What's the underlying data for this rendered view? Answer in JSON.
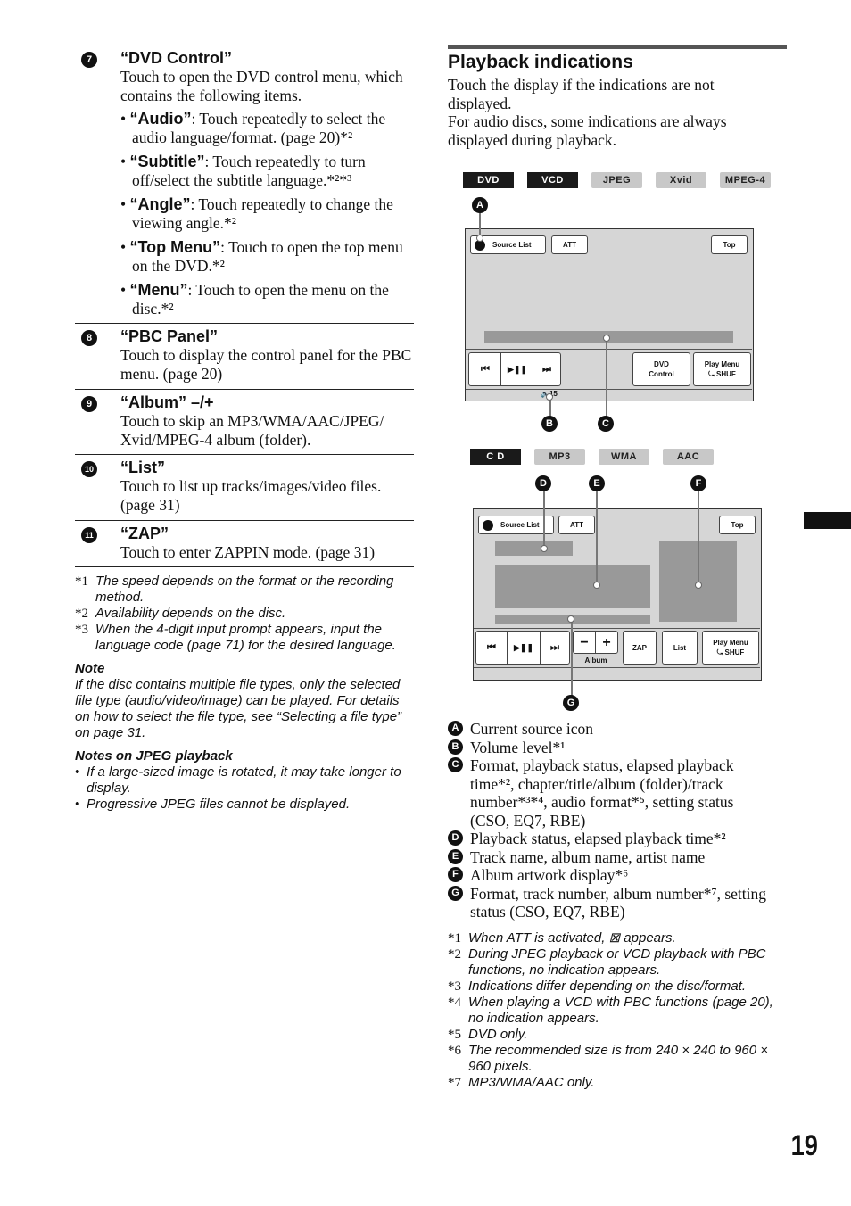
{
  "left": {
    "sections": [
      {
        "num": "7",
        "title": "“DVD Control”",
        "text": "Touch to open the DVD control menu, which contains the following items.",
        "bullets": [
          {
            "term": "“Audio”",
            "text": ": Touch repeatedly to select the audio language/format. (page 20)*²"
          },
          {
            "term": "“Subtitle”",
            "text": ": Touch repeatedly to turn off/select the subtitle language.*²*³"
          },
          {
            "term": "“Angle”",
            "text": ": Touch repeatedly to change the viewing angle.*²"
          },
          {
            "term": "“Top Menu”",
            "text": ": Touch to open the top menu on the DVD.*²"
          },
          {
            "term": "“Menu”",
            "text": ": Touch to open the menu on the disc.*²"
          }
        ]
      },
      {
        "num": "8",
        "title": "“PBC Panel”",
        "text": "Touch to display the control panel for the PBC menu. (page 20)"
      },
      {
        "num": "9",
        "title": "“Album” –/+",
        "text": "Touch to skip an MP3/WMA/AAC/JPEG/ Xvid/MPEG-4 album (folder)."
      },
      {
        "num": "10",
        "title": "“List”",
        "text": "Touch to list up tracks/images/video files. (page 31)"
      },
      {
        "num": "11",
        "title": "“ZAP”",
        "text": "Touch to enter ZAPPIN mode. (page 31)"
      }
    ],
    "footnotes": [
      {
        "mark": "*1",
        "text": "The speed depends on the format or the recording method."
      },
      {
        "mark": "*2",
        "text": "Availability depends on the disc."
      },
      {
        "mark": "*3",
        "text": "When the 4-digit input prompt appears, input the language code (page 71) for the desired language."
      }
    ],
    "note_title": "Note",
    "note_text": "If the disc contains multiple file types, only the selected file type (audio/video/image) can be played. For details on how to select the file type, see “Selecting a file type” on page 31.",
    "jpeg_title": "Notes on JPEG playback",
    "jpeg_bullets": [
      "If a large-sized image is rotated, it may take longer to display.",
      "Progressive JPEG files cannot be displayed."
    ]
  },
  "right": {
    "title": "Playback indications",
    "intro1": "Touch the display if the indications are not displayed.",
    "intro2": "For audio discs, some indications are always displayed during playback.",
    "diagram1": {
      "tags": [
        {
          "label": "DVD",
          "active": true
        },
        {
          "label": "VCD",
          "active": true
        },
        {
          "label": "JPEG",
          "active": false
        },
        {
          "label": "Xvid",
          "active": false
        },
        {
          "label": "MPEG-4",
          "active": false
        }
      ],
      "source_list": "Source List",
      "att": "ATT",
      "top": "Top",
      "prev_icon": "⏮",
      "play_pause_icon": "▶❚❚",
      "next_icon": "⏭",
      "dvd_control_1": "DVD",
      "dvd_control_2": "Control",
      "play_menu": "Play Menu",
      "shuf": "⤿ SHUF",
      "volume": "🔈15",
      "callouts": [
        "A",
        "B",
        "C"
      ]
    },
    "diagram2": {
      "tags": [
        {
          "label": "C D",
          "active": true
        },
        {
          "label": "MP3",
          "active": false
        },
        {
          "label": "WMA",
          "active": false
        },
        {
          "label": "AAC",
          "active": false
        }
      ],
      "source_list": "Source List",
      "att": "ATT",
      "top": "Top",
      "minus": "−",
      "plus": "+",
      "album": "Album",
      "zap": "ZAP",
      "list": "List",
      "play_menu": "Play Menu",
      "shuf": "⤿ SHUF",
      "callouts": [
        "D",
        "E",
        "F",
        "G"
      ]
    },
    "legend": [
      {
        "letter": "A",
        "text": "Current source icon"
      },
      {
        "letter": "B",
        "text": "Volume level*¹"
      },
      {
        "letter": "C",
        "text": "Format, playback status, elapsed playback time*², chapter/title/album (folder)/track number*³*⁴, audio format*⁵, setting status (CSO, EQ7, RBE)"
      },
      {
        "letter": "D",
        "text": "Playback status, elapsed playback time*²"
      },
      {
        "letter": "E",
        "text": "Track name, album name, artist name"
      },
      {
        "letter": "F",
        "text": "Album artwork display*⁶"
      },
      {
        "letter": "G",
        "text": "Format, track number, album number*⁷, setting status (CSO, EQ7, RBE)"
      }
    ],
    "footnotes": [
      {
        "mark": "*1",
        "text": "When ATT is activated, ⊠ appears."
      },
      {
        "mark": "*2",
        "text": "During JPEG playback or VCD playback with PBC functions, no indication appears."
      },
      {
        "mark": "*3",
        "text": "Indications differ depending on the disc/format."
      },
      {
        "mark": "*4",
        "text": "When playing a VCD with PBC functions (page 20), no indication appears."
      },
      {
        "mark": "*5",
        "text": "DVD only."
      },
      {
        "mark": "*6",
        "text": "The recommended size is from 240 × 240 to 960 × 960 pixels."
      },
      {
        "mark": "*7",
        "text": "MP3/WMA/AAC only."
      }
    ]
  },
  "page_number": "19"
}
